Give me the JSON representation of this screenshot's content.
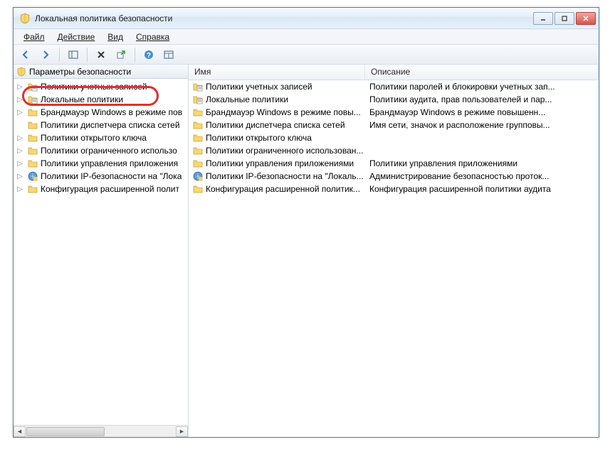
{
  "window": {
    "title": "Локальная политика безопасности"
  },
  "menu": {
    "file": "Файл",
    "action": "Действие",
    "view": "Вид",
    "help": "Справка"
  },
  "tree": {
    "root": "Параметры безопасности",
    "items": [
      {
        "label": "Политики учетных записей",
        "hasChildren": true,
        "iconType": "policy"
      },
      {
        "label": "Локальные политики",
        "hasChildren": true,
        "iconType": "policy",
        "highlighted": true
      },
      {
        "label": "Брандмауэр Windows в режиме пов",
        "hasChildren": true,
        "iconType": "folder"
      },
      {
        "label": "Политики диспетчера списка сетей",
        "hasChildren": false,
        "iconType": "folder"
      },
      {
        "label": "Политики открытого ключа",
        "hasChildren": true,
        "iconType": "folder"
      },
      {
        "label": "Политики ограниченного использо",
        "hasChildren": true,
        "iconType": "folder"
      },
      {
        "label": "Политики управления приложения",
        "hasChildren": true,
        "iconType": "folder"
      },
      {
        "label": "Политики IP-безопасности на \"Лока",
        "hasChildren": true,
        "iconType": "ipsec"
      },
      {
        "label": "Конфигурация расширенной полит",
        "hasChildren": true,
        "iconType": "folder"
      }
    ]
  },
  "list": {
    "columns": {
      "name": "Имя",
      "description": "Описание"
    },
    "rows": [
      {
        "name": "Политики учетных записей",
        "desc": "Политики паролей и блокировки учетных зап...",
        "iconType": "policy"
      },
      {
        "name": "Локальные политики",
        "desc": "Политики аудита, прав пользователей и пар...",
        "iconType": "policy"
      },
      {
        "name": "Брандмауэр Windows в режиме повы...",
        "desc": "Брандмауэр Windows в режиме повышенн...",
        "iconType": "folder"
      },
      {
        "name": "Политики диспетчера списка сетей",
        "desc": "Имя сети, значок и расположение групповы...",
        "iconType": "folder"
      },
      {
        "name": "Политики открытого ключа",
        "desc": "",
        "iconType": "folder"
      },
      {
        "name": "Политики ограниченного использован...",
        "desc": "",
        "iconType": "folder"
      },
      {
        "name": "Политики управления приложениями",
        "desc": "Политики управления приложениями",
        "iconType": "folder"
      },
      {
        "name": "Политики IP-безопасности на \"Локаль...",
        "desc": "Администрирование безопасностью проток...",
        "iconType": "ipsec"
      },
      {
        "name": "Конфигурация расширенной политик...",
        "desc": "Конфигурация расширенной политики аудита",
        "iconType": "folder"
      }
    ]
  }
}
